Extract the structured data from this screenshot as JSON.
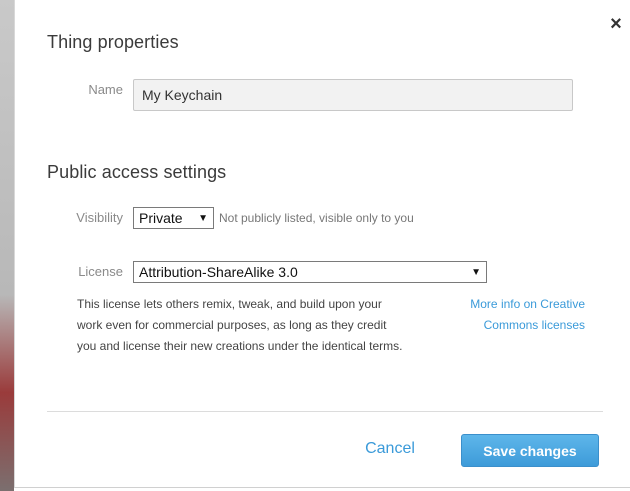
{
  "dialog": {
    "close_label": "×",
    "title": "Thing properties",
    "name_label": "Name",
    "name_value": "My Keychain",
    "public_access_title": "Public access settings",
    "visibility_label": "Visibility",
    "visibility_selected": "Private",
    "visibility_hint": "Not publicly listed, visible only to you",
    "license_label": "License",
    "license_selected": "Attribution-ShareAlike 3.0",
    "license_description": "This license lets others remix, tweak, and build upon your work even for commercial purposes, as long as they credit you and license their new creations under the identical terms.",
    "more_info_link": "More info on Creative Commons licenses",
    "cancel_label": "Cancel",
    "save_label": "Save changes"
  },
  "icons": {
    "close": "close-icon",
    "dropdown": "chevron-down-icon"
  },
  "colors": {
    "accent": "#3a9ad9",
    "save_button": "#4aa7e2",
    "title_text": "#3b3b3b",
    "label_text": "#8a8a8a"
  }
}
